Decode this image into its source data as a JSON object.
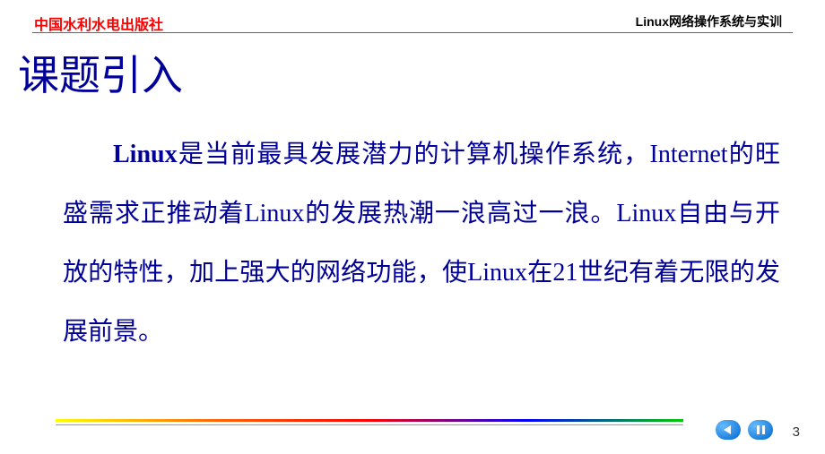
{
  "header": {
    "publisher": "中国水利水电出版社",
    "book_title": "Linux网络操作系统与实训"
  },
  "slide": {
    "title": "课题引入",
    "body_parts": {
      "p1": "Linux",
      "p2": "是当前最具发展潜力的计算机操作系统，Internet的旺盛需求正推动着Linux的发展热潮一浪高过一浪。Linux自由与开放的特性，加上强大的网络功能，使Linux在21世纪有着无限的发展前景。"
    }
  },
  "footer": {
    "page_number": "3"
  }
}
